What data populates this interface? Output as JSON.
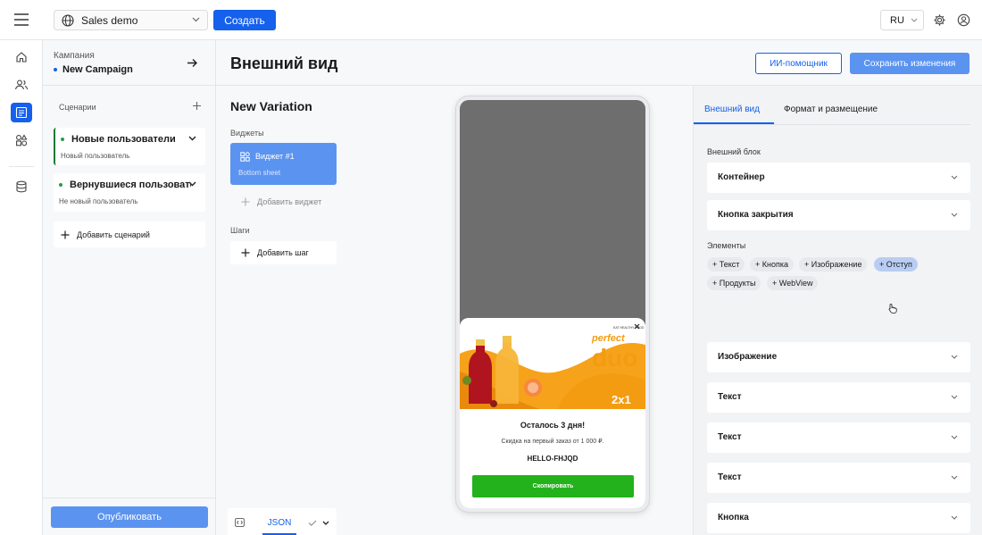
{
  "topbar": {
    "workspace": "Sales demo",
    "create_label": "Создать",
    "lang": "RU"
  },
  "sidebar": {
    "campaign_label": "Кампания",
    "campaign_name": "New Campaign",
    "scenarios_label": "Сценарии",
    "scenarios": [
      {
        "title": "Новые пользователи",
        "subtitle": "Новый пользователь"
      },
      {
        "title": "Вернувшиеся пользователи",
        "subtitle": "Не новый пользователь"
      }
    ],
    "add_scenario_label": "Добавить сценарий",
    "publish_label": "Опубликовать"
  },
  "main": {
    "title": "Внешний вид",
    "ai_label": "ИИ-помощник",
    "save_label": "Сохранить изменения",
    "variation_title": "New Variation",
    "widgets_label": "Виджеты",
    "widget": {
      "title": "Виджет #1",
      "subtitle": "Bottom sheet"
    },
    "add_widget_label": "Добавить виджет",
    "steps_label": "Шаги",
    "add_step_label": "Добавить шаг",
    "json_tab": "JSON"
  },
  "preview": {
    "banner_brand": "perfect",
    "banner_word": "duo",
    "banner_promo": "2x1",
    "banner_tagline": "EAT HEALTHY FOOD",
    "offer_title": "Осталось 3 дня!",
    "offer_sub": "Скидка на первый заказ от 1 000 ₽.",
    "offer_code": "HELLO-FHJQD",
    "copy_label": "Скопировать"
  },
  "rpanel": {
    "tabs": [
      "Внешний вид",
      "Формат и размещение"
    ],
    "outer_label": "Внешний блок",
    "outer_items": [
      "Контейнер",
      "Кнопка закрытия"
    ],
    "elements_label": "Элементы",
    "chips": [
      "+ Текст",
      "+ Кнопка",
      "+ Изображение",
      "+ Отступ",
      "+ Продукты",
      "+ WebView"
    ],
    "sections": [
      "Изображение",
      "Текст",
      "Текст",
      "Текст",
      "Кнопка"
    ]
  },
  "colors": {
    "accent": "#1560ec",
    "accent_light": "#5b93f0",
    "copy_button": "#23b21b",
    "scenario_dot": "#2b9a47"
  }
}
